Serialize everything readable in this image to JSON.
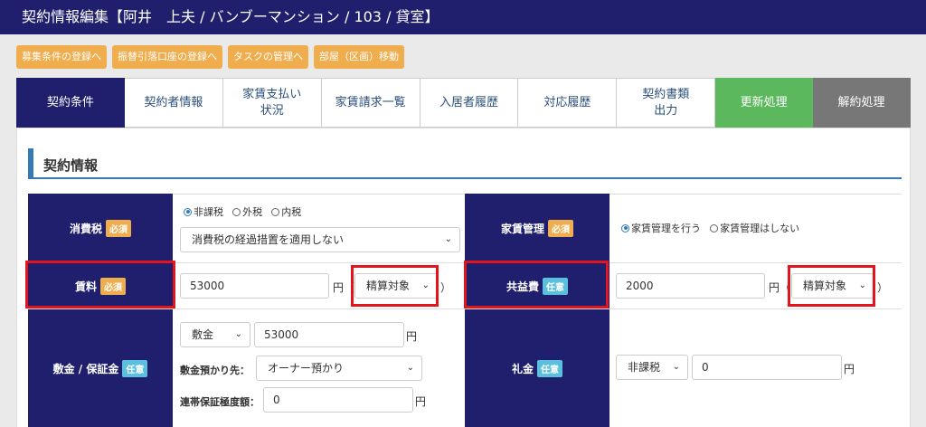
{
  "header": {
    "title": "契約情報編集【阿井　上夫 / バンブーマンション / 103 / 貸室】"
  },
  "top_buttons": [
    "募集条件の登録へ",
    "振替引落口座の登録へ",
    "タスクの管理へ",
    "部屋（区画）移動"
  ],
  "tabs": [
    {
      "label": "契約条件",
      "style": "active"
    },
    {
      "label": "契約者情報",
      "style": "normal"
    },
    {
      "label": "家賃支払い\n状況",
      "style": "normal"
    },
    {
      "label": "家賃請求一覧",
      "style": "normal"
    },
    {
      "label": "入居者履歴",
      "style": "normal"
    },
    {
      "label": "対応履歴",
      "style": "normal"
    },
    {
      "label": "契約書類\n出力",
      "style": "normal"
    },
    {
      "label": "更新処理",
      "style": "green"
    },
    {
      "label": "解約処理",
      "style": "gray"
    }
  ],
  "section": {
    "title": "契約情報"
  },
  "badges": {
    "required": "必須",
    "optional": "任意"
  },
  "yen": "円",
  "tax": {
    "label": "消費税",
    "radios": [
      "非課税",
      "外税",
      "内税"
    ],
    "selected": "非課税",
    "select": "消費税の経過措置を適用しない"
  },
  "rent_mgmt": {
    "label": "家賃管理",
    "radios": [
      "家賃管理を行う",
      "家賃管理はしない"
    ],
    "selected": "家賃管理を行う"
  },
  "rent": {
    "label": "賃料",
    "value": "53000",
    "paren_open": "（",
    "paren_close": "）",
    "settle": "精算対象"
  },
  "common_fee": {
    "label": "共益費",
    "value": "2000",
    "paren_open": "（",
    "paren_close": "）",
    "settle": "精算対象"
  },
  "deposit": {
    "label": "敷金 / 保証金",
    "type": "敷金",
    "value": "53000",
    "custody_label": "敷金預かり先：",
    "custody": "オーナー預かり",
    "guarantee_label": "連帯保証極度額：",
    "guarantee": "0"
  },
  "key_money": {
    "label": "礼金",
    "tax": "非課税",
    "value": "0"
  },
  "colors": {
    "navy": "#1f1f6e",
    "accent": "#f0ad4e",
    "highlight": "#e3141b"
  }
}
